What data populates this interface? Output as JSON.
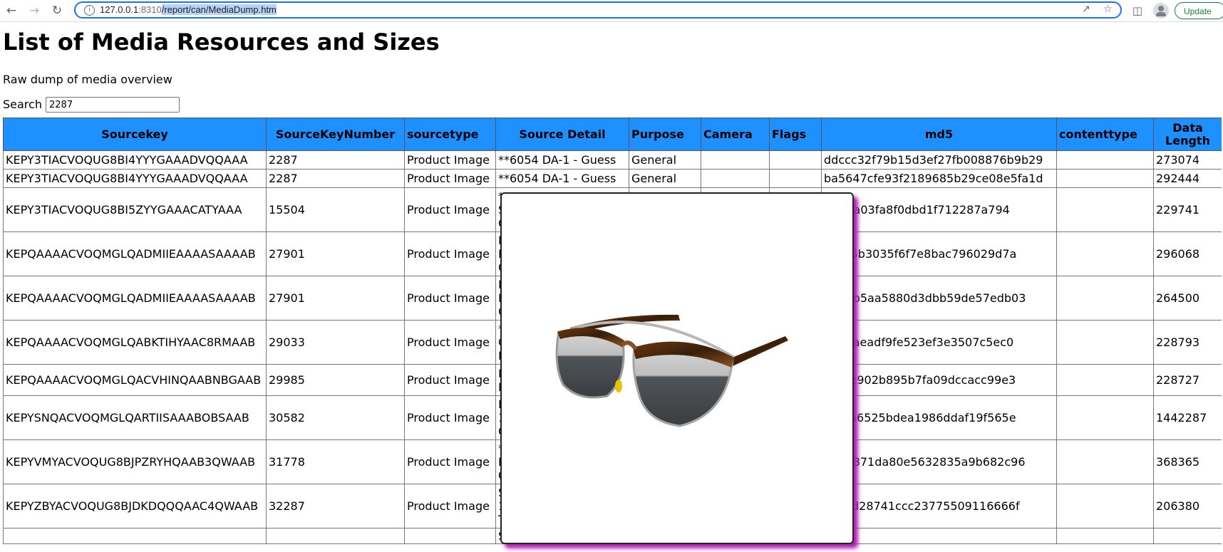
{
  "browser": {
    "url_host": "127.0.0.1",
    "url_port": ":8310",
    "url_path": "/report/can/MediaDump.htm",
    "update_label": "Update"
  },
  "page": {
    "title": "List of Media Resources and Sizes",
    "subtitle": "Raw dump of media overview",
    "search_label": "Search",
    "search_value": "2287"
  },
  "table": {
    "headers": {
      "sourcekey": "Sourcekey",
      "sourcekeynumber": "SourceKeyNumber",
      "sourcetype": "sourcetype",
      "sourcedetail": "Source Detail",
      "purpose": "Purpose",
      "camera": "Camera",
      "flags": "Flags",
      "md5": "md5",
      "contenttype": "contenttype",
      "datalength_1": "Data",
      "datalength_2": "Length"
    },
    "rows": [
      {
        "sourcekey": "KEPY3TIACVOQUG8BI4YYYGAAADVQQAAA",
        "number": "2287",
        "type": "Product Image",
        "detail": [
          "**6054 DA-1 - Guess"
        ],
        "purpose": "General",
        "md5": "ddccc32f79b15d3ef27fb008876b9b29",
        "length": "273074"
      },
      {
        "sourcekey": "KEPY3TIACVOQUG8BI4YYYGAAADVQQAAA",
        "number": "2287",
        "type": "Product Image",
        "detail": [
          "**6054 DA-1 - Guess"
        ],
        "purpose": "General",
        "md5": "ba5647cfe93f2189685b29ce08e5fa1d",
        "length": "292444"
      },
      {
        "sourcekey": "KEPY3TIACVOQUG8BI5ZYYGAAACATYAAA",
        "number": "15504",
        "type": "Product Image",
        "detail": [
          "*",
          "S",
          "C"
        ],
        "purpose": "",
        "md5": "ffb27a03fa8f0dbd1f712287a794",
        "length": "229741"
      },
      {
        "sourcekey": "KEPQAAAACVOQMGLQADMIIEAAAASAAAAB",
        "number": "27901",
        "type": "Product Image",
        "detail": [
          "E",
          "E",
          "C"
        ],
        "purpose": "",
        "md5": "9cec5b3035f6f7e8bac796029d7a",
        "length": "296068"
      },
      {
        "sourcekey": "KEPQAAAACVOQMGLQADMIIEAAAASAAAAB",
        "number": "27901",
        "type": "Product Image",
        "detail": [
          "E",
          "E",
          "C"
        ],
        "purpose": "",
        "md5": "4b16b5aa5880d3dbb59de57edb03",
        "length": "264500"
      },
      {
        "sourcekey": "KEPQAAAACVOQMGLQABKTIHYAAC8RMAAB",
        "number": "29033",
        "type": "Product Image",
        "detail": [
          "*",
          "C",
          "E"
        ],
        "purpose": "",
        "md5": "5107aeadf9fe523ef3e3507c5ec0",
        "length": "228793"
      },
      {
        "sourcekey": "KEPQAAAACVOQMGLQACVHINQAABNBGAAB",
        "number": "29985",
        "type": "Product Image",
        "detail": [
          "E",
          "F"
        ],
        "purpose": "",
        "md5": "40fd2902b895b7fa09dccacc99e3",
        "length": "228727"
      },
      {
        "sourcekey": "KEPYSNQACVOQMGLQARTIISAAABOBSAAB",
        "number": "30582",
        "type": "Product Image",
        "detail": [
          "N",
          "1",
          "C"
        ],
        "purpose": "",
        "md5": "e13f66525bdea1986ddaf19f565e",
        "length": "1442287"
      },
      {
        "sourcekey": "KEPYVMYACVOQUG8BJPZRYHQAAB3QWAAB",
        "number": "31778",
        "type": "Product Image",
        "detail": [
          "*",
          "E",
          "C"
        ],
        "purpose": "",
        "md5": "0b22871da80e5632835a9b682c96",
        "length": "368365"
      },
      {
        "sourcekey": "KEPYZBYACVOQUG8BJDKDQQQAAC4QWAAB",
        "number": "32287",
        "type": "Product Image",
        "detail": [
          "S",
          "1",
          "T"
        ],
        "purpose": "",
        "md5": "cb7ed28741ccc23775509116666f",
        "length": "206380"
      },
      {
        "sourcekey": "",
        "number": "",
        "type": "",
        "detail": [
          "SE BURLEIGH"
        ],
        "purpose": "",
        "md5": "",
        "length": ""
      }
    ]
  },
  "popup": {
    "image": "sunglasses-image"
  },
  "colors": {
    "header_bg": "#1e90ff",
    "popup_shadow": "#b020b0"
  }
}
